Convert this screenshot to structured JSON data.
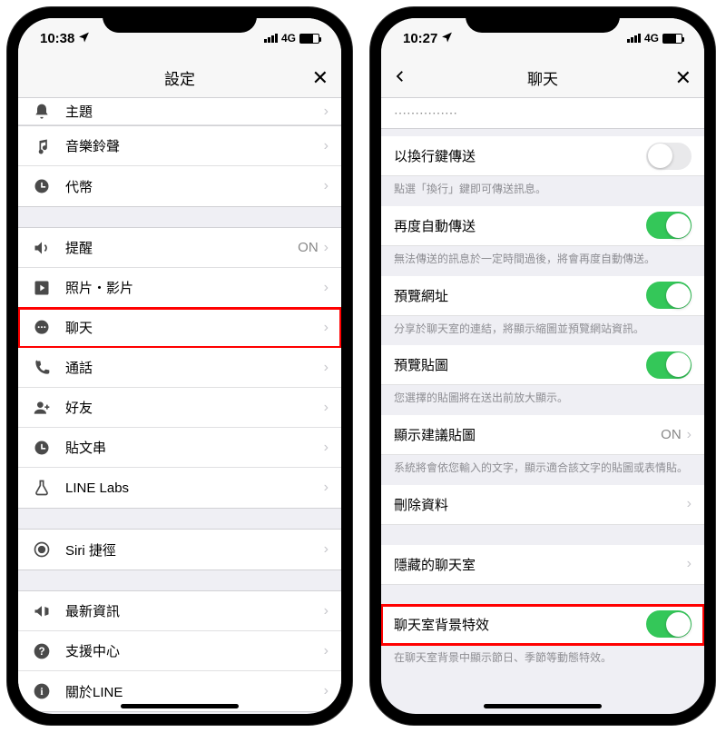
{
  "left": {
    "time": "10:38",
    "network": "4G",
    "title": "設定",
    "truncated": "主題",
    "g1": [
      {
        "icon": "music",
        "label": "音樂鈴聲"
      },
      {
        "icon": "clock",
        "label": "代幣"
      }
    ],
    "g2": [
      {
        "icon": "speaker",
        "label": "提醒",
        "value": "ON"
      },
      {
        "icon": "play",
        "label": "照片・影片"
      },
      {
        "icon": "chat",
        "label": "聊天",
        "hl": true
      },
      {
        "icon": "phone",
        "label": "通話"
      },
      {
        "icon": "friend",
        "label": "好友"
      },
      {
        "icon": "clock",
        "label": "貼文串"
      },
      {
        "icon": "flask",
        "label": "LINE Labs"
      }
    ],
    "g3": [
      {
        "icon": "siri",
        "label": "Siri 捷徑"
      }
    ],
    "g4": [
      {
        "icon": "mega",
        "label": "最新資訊"
      },
      {
        "icon": "help",
        "label": "支援中心"
      },
      {
        "icon": "info",
        "label": "關於LINE"
      }
    ]
  },
  "right": {
    "time": "10:27",
    "network": "4G",
    "title": "聊天",
    "items": [
      {
        "type": "row",
        "label": "以換行鍵傳送",
        "toggle": "off"
      },
      {
        "type": "desc",
        "text": "點選「換行」鍵即可傳送訊息。"
      },
      {
        "type": "row",
        "label": "再度自動傳送",
        "toggle": "on"
      },
      {
        "type": "desc",
        "text": "無法傳送的訊息於一定時間過後，將會再度自動傳送。"
      },
      {
        "type": "row",
        "label": "預覽網址",
        "toggle": "on"
      },
      {
        "type": "desc",
        "text": "分享於聊天室的連結，將顯示縮圖並預覽網站資訊。"
      },
      {
        "type": "row",
        "label": "預覽貼圖",
        "toggle": "on"
      },
      {
        "type": "desc",
        "text": "您選擇的貼圖將在送出前放大顯示。"
      },
      {
        "type": "row",
        "label": "顯示建議貼圖",
        "value": "ON",
        "chev": true
      },
      {
        "type": "desc",
        "text": "系統將會依您輸入的文字，顯示適合該文字的貼圖或表情貼。"
      },
      {
        "type": "row",
        "label": "刪除資料",
        "chev": true
      },
      {
        "type": "gap"
      },
      {
        "type": "row",
        "label": "隱藏的聊天室",
        "chev": true
      },
      {
        "type": "gap"
      },
      {
        "type": "row",
        "label": "聊天室背景特效",
        "toggle": "on",
        "hl": true
      },
      {
        "type": "desc",
        "text": "在聊天室背景中顯示節日、季節等動態特效。"
      }
    ]
  }
}
